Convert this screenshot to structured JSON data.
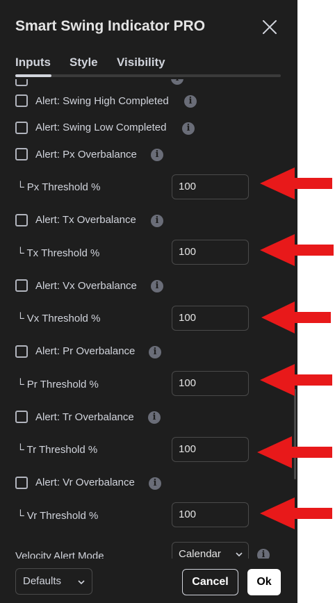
{
  "dialog": {
    "title": "Smart Swing Indicator PRO",
    "close_icon": "close-icon"
  },
  "tabs": [
    {
      "label": "Inputs",
      "active": true
    },
    {
      "label": "Style",
      "active": false
    },
    {
      "label": "Visibility",
      "active": false
    }
  ],
  "rows": {
    "alert_swing_high": {
      "label": "Alert: Swing High Completed",
      "checked": false
    },
    "alert_swing_low": {
      "label": "Alert: Swing Low Completed",
      "checked": false
    },
    "alert_px": {
      "label": "Alert: Px Overbalance",
      "checked": false
    },
    "px_threshold": {
      "label": "└ Px Threshold %",
      "value": "100"
    },
    "alert_tx": {
      "label": "Alert: Tx Overbalance",
      "checked": false
    },
    "tx_threshold": {
      "label": "└ Tx Threshold %",
      "value": "100"
    },
    "alert_vx": {
      "label": "Alert: Vx Overbalance",
      "checked": false
    },
    "vx_threshold": {
      "label": "└ Vx Threshold %",
      "value": "100"
    },
    "alert_pr": {
      "label": "Alert: Pr Overbalance",
      "checked": false
    },
    "pr_threshold": {
      "label": "└ Pr Threshold %",
      "value": "100"
    },
    "alert_tr": {
      "label": "Alert: Tr Overbalance",
      "checked": false
    },
    "tr_threshold": {
      "label": "└ Tr Threshold %",
      "value": "100"
    },
    "alert_vr": {
      "label": "Alert: Vr Overbalance",
      "checked": false
    },
    "vr_threshold": {
      "label": "└ Vr Threshold %",
      "value": "100"
    },
    "velocity_mode": {
      "label": "Velocity Alert Mode",
      "value": "Calendar"
    }
  },
  "info_icon_glyph": "i",
  "footer": {
    "defaults_label": "Defaults",
    "cancel_label": "Cancel",
    "ok_label": "Ok"
  },
  "colors": {
    "dialog_bg": "#1e1e1e",
    "text": "#d1d4dc",
    "annotation_arrow": "#e8191a"
  }
}
